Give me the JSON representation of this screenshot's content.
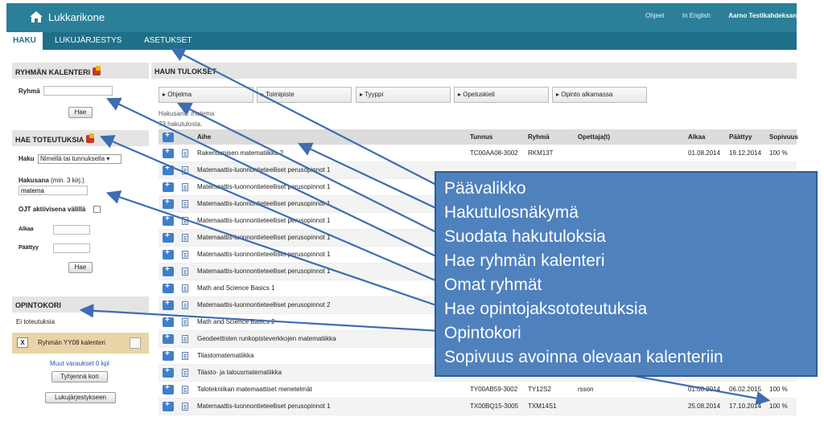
{
  "app": {
    "title": "Lukkarikone"
  },
  "toplinks": {
    "help": "Ohjeet",
    "english": "In English",
    "user": "Aarno Testikahdeksan"
  },
  "nav": {
    "tabs": [
      "HAKU",
      "LUKUJÄRJESTYS",
      "ASETUKSET"
    ]
  },
  "group_calendar": {
    "title": "RYHMÄN KALENTERI",
    "group_label": "Ryhmä",
    "group_value": "",
    "button": "Hae"
  },
  "find_impl": {
    "title": "HAE TOTEUTUKSIA",
    "search_label": "Haku",
    "search_select": "Nimellä tai tunnuksella",
    "term_label": "Hakusana",
    "term_hint": "(min. 3 kirj.)",
    "term_value": "matema",
    "ojt_label": "OJT aktiivisena välillä",
    "start_label": "Alkaa",
    "end_label": "Päättyy",
    "button": "Hae"
  },
  "cart": {
    "title": "OPINTOKORI",
    "empty_text": "Ei toteutuksia",
    "item_x": "X",
    "item_label": "Ryhmän YY08 kalenteri",
    "other_reservations": "Muut varaukset 0 kpl",
    "clear_button": "Tyhjennä kori",
    "to_schedule_button": "Lukujärjestykseen"
  },
  "results": {
    "title": "HAUN TULOKSET",
    "filters": [
      "Ohjelma",
      "Toimipiste",
      "Tyyppi",
      "Opetuskieli",
      "Opinto alkamassa"
    ],
    "search_term_text": "Hakusana: matema",
    "count_text": "73 hakutulosta.",
    "columns": [
      "Aihe",
      "Tunnus",
      "Ryhmä",
      "Opettaja(t)",
      "Alkaa",
      "Päättyy",
      "Sopivuus"
    ],
    "rows": [
      {
        "subject": "Rakentamisen matematiikka 2",
        "code": "TC00AA08-3002",
        "group": "RKM13T",
        "teacher": "",
        "start": "01.08.2014",
        "end": "19.12.2014",
        "fit": "100 %"
      },
      {
        "subject": "Matemaattis-luonnontieteelliset perusopinnot 1",
        "code": "",
        "group": "",
        "teacher": "",
        "start": "",
        "end": "",
        "fit": ""
      },
      {
        "subject": "Matemaattis-luonnontieteelliset perusopinnot 1",
        "code": "",
        "group": "",
        "teacher": "",
        "start": "",
        "end": "",
        "fit": ""
      },
      {
        "subject": "Matemaattis-luonnontieteelliset perusopinnot 1",
        "code": "",
        "group": "",
        "teacher": "",
        "start": "",
        "end": "",
        "fit": ""
      },
      {
        "subject": "Matemaattis-luonnontieteelliset perusopinnot 1",
        "code": "",
        "group": "",
        "teacher": "",
        "start": "",
        "end": "",
        "fit": ""
      },
      {
        "subject": "Matemaattis-luonnontieteelliset perusopinnot 1",
        "code": "",
        "group": "",
        "teacher": "",
        "start": "",
        "end": "",
        "fit": ""
      },
      {
        "subject": "Matemaattis-luonnontieteelliset perusopinnot 1",
        "code": "",
        "group": "",
        "teacher": "",
        "start": "",
        "end": "",
        "fit": ""
      },
      {
        "subject": "Matemaattis-luonnontieteelliset perusopinnot 1",
        "code": "",
        "group": "",
        "teacher": "",
        "start": "",
        "end": "",
        "fit": ""
      },
      {
        "subject": "Math and Science Basics 1",
        "code": "",
        "group": "",
        "teacher": "",
        "start": "",
        "end": "",
        "fit": ""
      },
      {
        "subject": "Matemaattis-luonnontieteelliset perusopinnot 2",
        "code": "",
        "group": "",
        "teacher": "",
        "start": "",
        "end": "",
        "fit": ""
      },
      {
        "subject": "Math and Science Basics 2",
        "code": "",
        "group": "",
        "teacher": "",
        "start": "",
        "end": "",
        "fit": ""
      },
      {
        "subject": "Geodeettisten runkopisteverkkojen matematiikka",
        "code": "",
        "group": "",
        "teacher": "",
        "start": "",
        "end": "",
        "fit": ""
      },
      {
        "subject": "Tilastomatematiikka",
        "code": "",
        "group": "",
        "teacher": "",
        "start": "",
        "end": "",
        "fit": ""
      },
      {
        "subject": "Tilasto- ja talousmatematiikka",
        "code": "",
        "group": "",
        "teacher": "",
        "start": "",
        "end": "",
        "fit": ""
      },
      {
        "subject": "Talotekniikan matemaattiset menetelmät",
        "code": "TY00AB59-3002",
        "group": "TY12S2",
        "teacher": "rsson",
        "start": "01.08.2014",
        "end": "06.02.2015",
        "fit": "100 %"
      },
      {
        "subject": "Matemaattis-luonnontieteelliset perusopinnot 1",
        "code": "TX00BQ15-3005",
        "group": "TXM14S1",
        "teacher": "",
        "start": "25.08.2014",
        "end": "17.10.2014",
        "fit": "100 %"
      }
    ]
  },
  "callout": {
    "lines": [
      "Päävalikko",
      "Hakutulosnäkymä",
      "Suodata hakutuloksia",
      "Hae ryhmän kalenteri",
      "Omat ryhmät",
      "Hae opintojaksototeutuksia",
      "Opintokori",
      "Sopivuus avoinna olevaan kalenteriin"
    ]
  },
  "colors": {
    "topbar": "#2b7f98",
    "navbar": "#1f6f88",
    "callout": "#4f81bd",
    "cart_item": "#e8d4a6"
  }
}
